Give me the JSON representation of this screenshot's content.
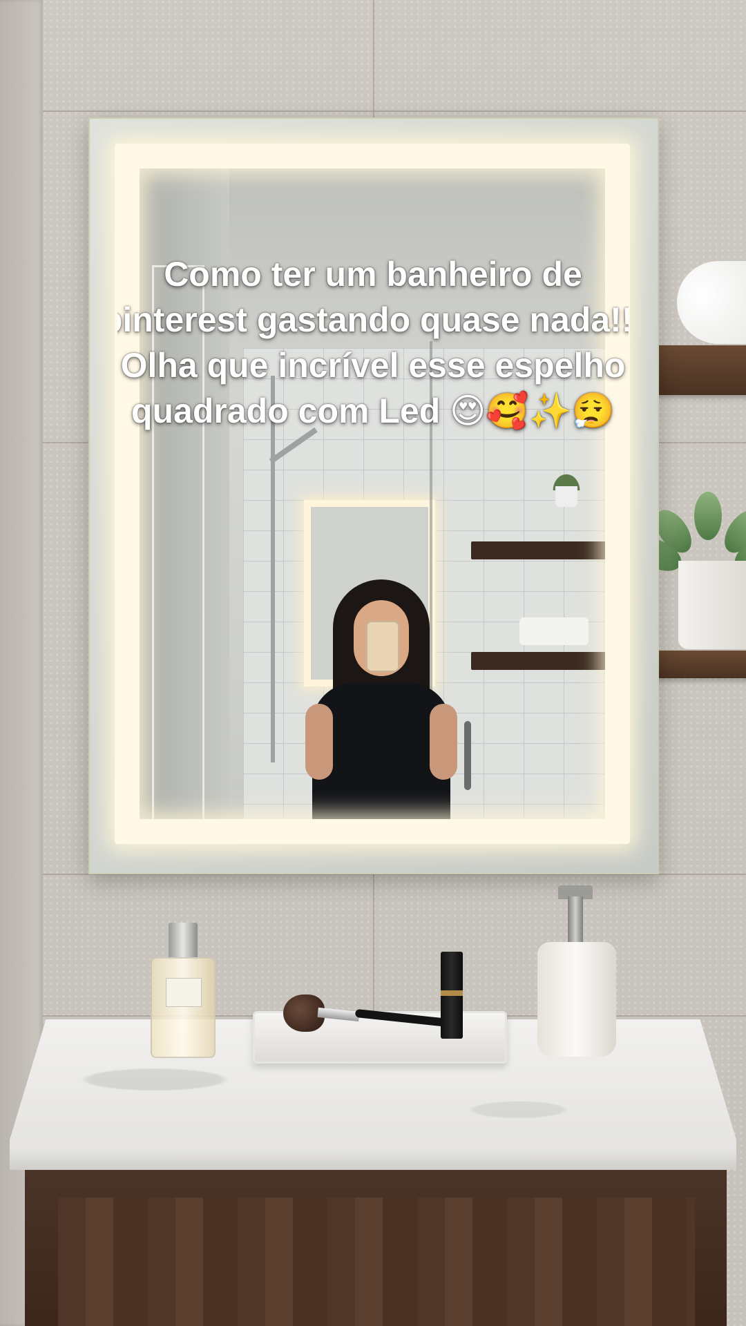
{
  "caption": {
    "text": "Como ter um banheiro de pinterest gastando quase nada!!! Olha que incrível esse espelho quadrado com Led 😍🥰✨😮‍💨"
  },
  "colors": {
    "wall": "#c9c4bd",
    "led": "#fff8e6",
    "wood": "#4a3222",
    "marble": "#efeeeb"
  }
}
